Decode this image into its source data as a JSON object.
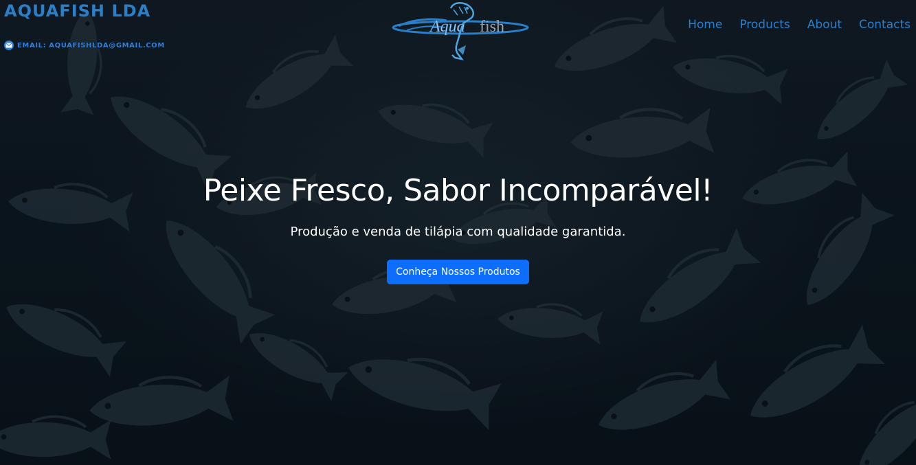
{
  "header": {
    "brand_title": "AQUAFISH LDA",
    "email_label": "EMAIL: AQUAFISHLDA@GMAIL.COM",
    "email_icon": "envelope-icon",
    "logo_text_left": "Aqua",
    "logo_text_right": "fish"
  },
  "nav": {
    "items": [
      {
        "label": "Home"
      },
      {
        "label": "Products"
      },
      {
        "label": "About"
      },
      {
        "label": "Contacts"
      }
    ]
  },
  "hero": {
    "title": "Peixe Fresco, Sabor Incomparável!",
    "subtitle": "Produção e venda de tilápia com qualidade garantida.",
    "cta_label": "Conheça Nossos Produtos"
  },
  "colors": {
    "brand_blue": "#2a7fc9",
    "cta_blue": "#0d6efd",
    "background": "#0b1620"
  }
}
